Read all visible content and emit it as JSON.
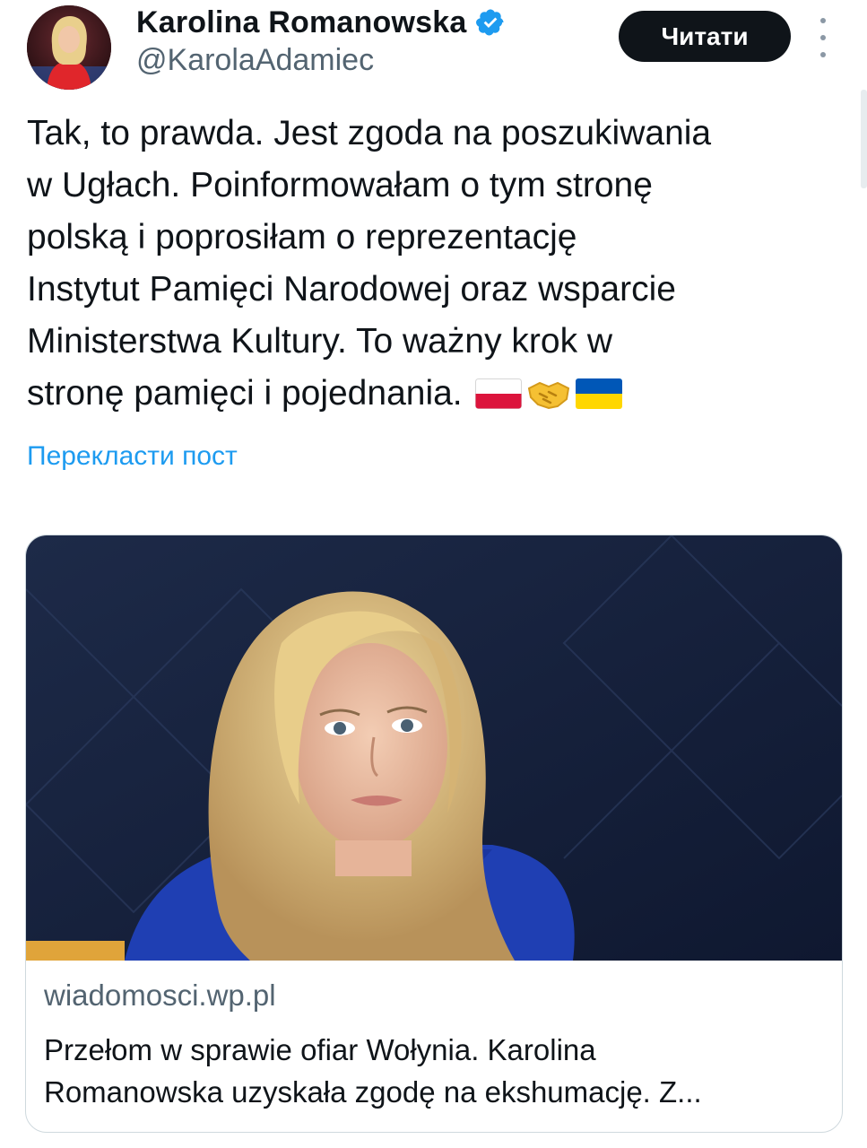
{
  "author": {
    "display_name": "Karolina Romanowska",
    "handle": "@KarolaAdamiec",
    "verified_color": "#1d9bf0"
  },
  "header": {
    "follow_label": "Читати"
  },
  "post": {
    "lines": [
      "Tak, to prawda. Jest zgoda na poszukiwania",
      "w Ugłach. Poinformowałam o tym stronę",
      "polską i poprosiłam o reprezentację",
      "Instytut Pamięci Narodowej oraz wsparcie",
      "Ministerstwa Kultury. To ważny krok w",
      "stronę pamięci i pojednania."
    ],
    "emojis": [
      "flag-poland-icon",
      "handshake-icon",
      "flag-ukraine-icon"
    ],
    "translate_label": "Перекласти пост"
  },
  "card": {
    "domain": "wiadomosci.wp.pl",
    "title_lines": [
      "Przełom w sprawie ofiar Wołynia. Karolina",
      "Romanowska uzyskała zgodę na ekshumację. Z..."
    ]
  },
  "colors": {
    "accent": "#1d9bf0",
    "text": "#0f1419",
    "secondary": "#536471",
    "border": "#cfd9de"
  }
}
